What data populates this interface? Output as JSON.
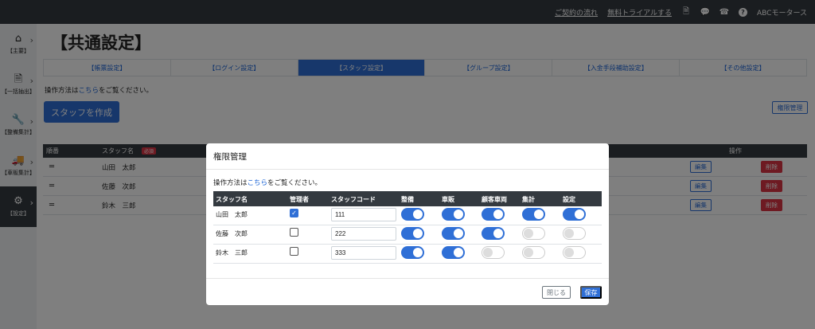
{
  "topbar": {
    "contract_flow": "ご契約の流れ",
    "free_trial": "無料トライアルする",
    "company": "ABCモータース",
    "icons": [
      "file-icon",
      "chat-icon",
      "phone-icon",
      "help-icon"
    ]
  },
  "sidebar": {
    "items": [
      {
        "label": "【主要】",
        "icon": "home-icon"
      },
      {
        "label": "【一括抽出】",
        "icon": "export-icon"
      },
      {
        "label": "【整備集計】",
        "icon": "wrench-icon"
      },
      {
        "label": "【車販集計】",
        "icon": "truck-icon"
      },
      {
        "label": "【設定】",
        "icon": "gear-icon"
      }
    ]
  },
  "main": {
    "title": "【共通設定】",
    "tabs": [
      "【帳票設定】",
      "【ログイン設定】",
      "【スタッフ設定】",
      "【グループ設定】",
      "【入金手段補助設定】",
      "【その他設定】"
    ],
    "howto_prefix": "操作方法は",
    "howto_link": "こちら",
    "howto_suffix": "をご覧ください。",
    "create_button": "スタッフを作成",
    "permission_button": "権限管理",
    "table": {
      "col_no": "順番",
      "col_name": "スタッフ名",
      "required_badge": "必須",
      "col_action": "操作",
      "handle": "═",
      "edit_label": "編集",
      "delete_label": "削除",
      "rows": [
        "山田　太郎",
        "佐藤　次郎",
        "鈴木　三郎"
      ]
    }
  },
  "modal": {
    "title": "権限管理",
    "howto_prefix": "操作方法は",
    "howto_link": "こちら",
    "howto_suffix": "をご覧ください。",
    "columns": [
      "スタッフ名",
      "管理者",
      "スタッフコード",
      "整備",
      "車販",
      "顧客車両",
      "集計",
      "設定"
    ],
    "rows": [
      {
        "name": "山田　太郎",
        "admin": true,
        "code": "111",
        "perms": [
          true,
          true,
          true,
          true,
          true
        ]
      },
      {
        "name": "佐藤　次郎",
        "admin": false,
        "code": "222",
        "perms": [
          true,
          true,
          true,
          false,
          false
        ]
      },
      {
        "name": "鈴木　三郎",
        "admin": false,
        "code": "333",
        "perms": [
          true,
          true,
          false,
          false,
          false
        ]
      }
    ],
    "close_button": "閉じる",
    "save_button": "保存"
  },
  "colors": {
    "primary": "#2f6fd6",
    "danger": "#dc3545",
    "dark": "#343a40"
  }
}
